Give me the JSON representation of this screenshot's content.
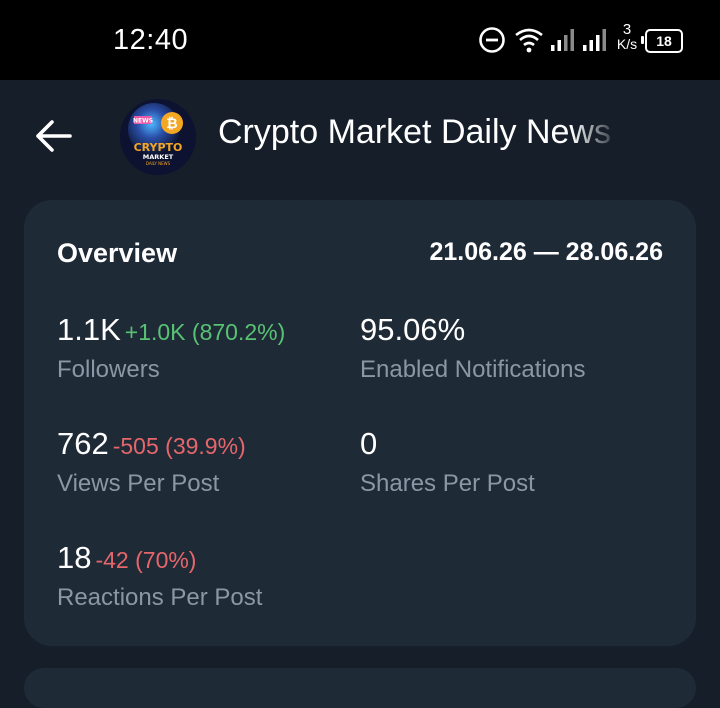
{
  "status_bar": {
    "time": "12:40",
    "network_speed_value": "3",
    "network_speed_unit": "K/s",
    "battery": "18",
    "icons": [
      "do-not-disturb-icon",
      "wifi-icon",
      "signal-icon",
      "signal-icon",
      "battery-icon"
    ]
  },
  "header": {
    "back_icon": "arrow-left-icon",
    "channel_title": "Crypto Market Daily News",
    "avatar": {
      "badge": "NEWS",
      "line1": "CRYPTO",
      "line2": "MARKET",
      "line3": "DAILY NEWS",
      "colors": {
        "gold": "#f5a623",
        "bg": "#0c1230",
        "glow": "#4fb8ff"
      }
    }
  },
  "overview": {
    "title": "Overview",
    "date_range": "21.06.26 — 28.06.26",
    "stats": [
      {
        "value": "1.1K",
        "change": "+1.0K (870.2%)",
        "change_type": "positive",
        "label": "Followers"
      },
      {
        "value": "95.06%",
        "change": "",
        "change_type": "none",
        "label": "Enabled Notifications"
      },
      {
        "value": "762",
        "change": "-505 (39.9%)",
        "change_type": "negative",
        "label": "Views Per Post"
      },
      {
        "value": "0",
        "change": "",
        "change_type": "none",
        "label": "Shares Per Post"
      },
      {
        "value": "18",
        "change": "-42 (70%)",
        "change_type": "negative",
        "label": "Reactions Per Post"
      }
    ]
  },
  "colors": {
    "background": "#151e29",
    "card": "#1f2a37",
    "label": "#8b97a5",
    "positive": "#58c273",
    "negative": "#e5666b"
  }
}
